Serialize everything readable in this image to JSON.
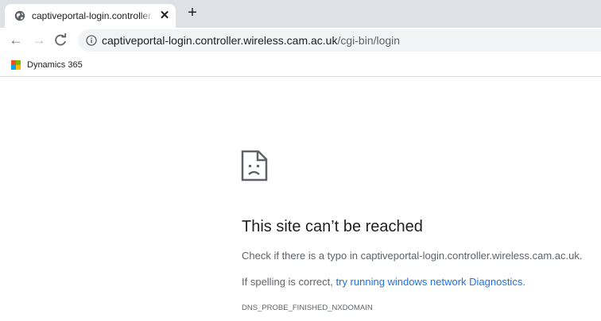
{
  "tab": {
    "title": "captiveportal-login.controller.wireless.cam.ac.uk/cgi-bin/login",
    "close_glyph": "✕",
    "favicon": "globe-icon"
  },
  "new_tab_glyph": "+",
  "toolbar": {
    "back_glyph": "←",
    "forward_glyph": "→",
    "reload_glyph": "C",
    "url_host": "captiveportal-login.controller.wireless.cam.ac.uk",
    "url_path": "/cgi-bin/login"
  },
  "bookmarks": [
    {
      "label": "Dynamics 365",
      "icon": "microsoft-logo-icon"
    }
  ],
  "error": {
    "title": "This site can’t be reached",
    "line1": "Check if there is a typo in captiveportal-login.controller.wireless.cam.ac.uk.",
    "line2_prefix": "If spelling is correct, ",
    "line2_link": "try running windows network Diagnostics",
    "line2_suffix": ".",
    "code": "DNS_PROBE_FINISHED_NXDOMAIN"
  },
  "colors": {
    "tab_strip": "#dee1e6",
    "omnibox": "#f1f3f4",
    "link": "#1a73e8",
    "microsoft_red": "#f25022",
    "microsoft_green": "#7fba00",
    "microsoft_blue": "#00a4ef",
    "microsoft_yellow": "#ffb900"
  }
}
